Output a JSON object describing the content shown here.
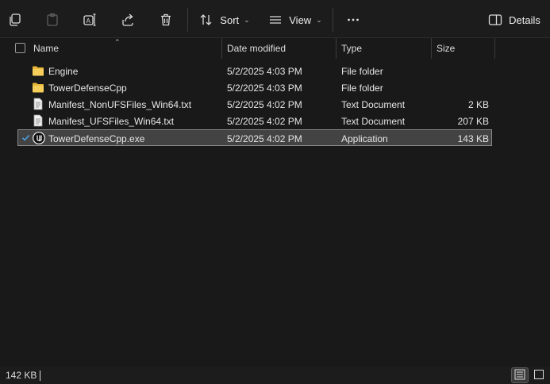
{
  "toolbar": {
    "sort_label": "Sort",
    "view_label": "View",
    "details_label": "Details",
    "icons": [
      "copy-icon",
      "paste-icon",
      "rename-icon",
      "share-icon",
      "delete-icon",
      "sort-icon",
      "view-icon",
      "more-icon",
      "details-pane-icon"
    ]
  },
  "columns": {
    "name": "Name",
    "date": "Date modified",
    "type": "Type",
    "size": "Size"
  },
  "files": [
    {
      "name": "Engine",
      "date": "5/2/2025 4:03 PM",
      "type": "File folder",
      "size": "",
      "icon": "folder-icon",
      "selected": false
    },
    {
      "name": "TowerDefenseCpp",
      "date": "5/2/2025 4:03 PM",
      "type": "File folder",
      "size": "",
      "icon": "folder-icon",
      "selected": false
    },
    {
      "name": "Manifest_NonUFSFiles_Win64.txt",
      "date": "5/2/2025 4:02 PM",
      "type": "Text Document",
      "size": "2 KB",
      "icon": "text-file-icon",
      "selected": false
    },
    {
      "name": "Manifest_UFSFiles_Win64.txt",
      "date": "5/2/2025 4:02 PM",
      "type": "Text Document",
      "size": "207 KB",
      "icon": "text-file-icon",
      "selected": false
    },
    {
      "name": "TowerDefenseCpp.exe",
      "date": "5/2/2025 4:02 PM",
      "type": "Application",
      "size": "143 KB",
      "icon": "unreal-engine-icon",
      "selected": true
    }
  ],
  "status": {
    "selection_size": "142 KB"
  },
  "colors": {
    "background": "#191919",
    "selection": "#434343",
    "folder": "#f2c94c",
    "accent": "#4ca0e0"
  }
}
